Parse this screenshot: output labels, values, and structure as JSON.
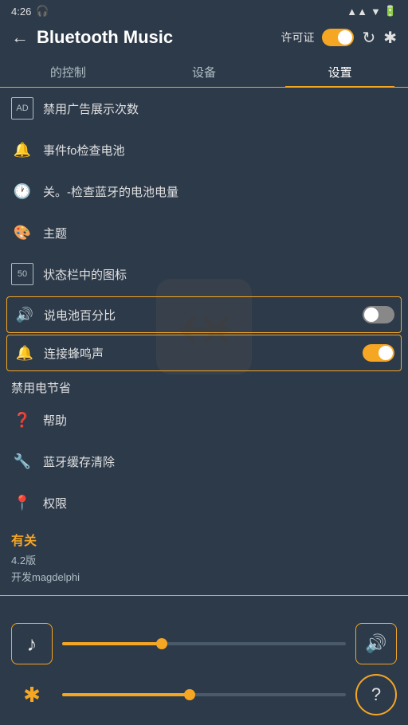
{
  "statusBar": {
    "time": "4:26",
    "headphoneIcon": "🎧",
    "batteryIcon": "🔋"
  },
  "header": {
    "backLabel": "←",
    "title": "Bluetooth Music",
    "permitLabel": "许可证",
    "refreshIcon": "↻",
    "bluetoothIcon": "✱"
  },
  "tabs": [
    {
      "label": "的控制",
      "active": false
    },
    {
      "label": "设备",
      "active": false
    },
    {
      "label": "设置",
      "active": true
    }
  ],
  "settingsItems": [
    {
      "icon": "AD",
      "label": "禁用广告展示次数",
      "type": "normal"
    },
    {
      "icon": "🔔",
      "label": "事件fo检查电池",
      "type": "normal"
    },
    {
      "icon": "🕐",
      "label": "关。-检查蓝牙的电池电量",
      "type": "normal"
    },
    {
      "icon": "🎨",
      "label": "主题",
      "type": "normal"
    },
    {
      "icon": "50",
      "label": "状态栏中的图标",
      "type": "normal"
    }
  ],
  "toggleItems": [
    {
      "icon": "🔊",
      "label": "说电池百分比",
      "toggled": false
    },
    {
      "icon": "🔔",
      "label": "连接蜂鸣声",
      "toggled": true
    }
  ],
  "toggleOffLabel": "禁用电节省",
  "extraItems": [
    {
      "icon": "❓",
      "label": "帮助"
    },
    {
      "icon": "🔧",
      "label": "蓝牙缓存清除"
    },
    {
      "icon": "📍",
      "label": "权限"
    }
  ],
  "about": {
    "title": "有关",
    "version": "4.2版",
    "developer": "开发magdelphi"
  },
  "player": {
    "musicIcon": "♪",
    "volumeIcon": "🔊",
    "bluetoothIcon": "✱",
    "helpIcon": "?",
    "volumeSliderPct": 35,
    "btSliderPct": 45
  }
}
